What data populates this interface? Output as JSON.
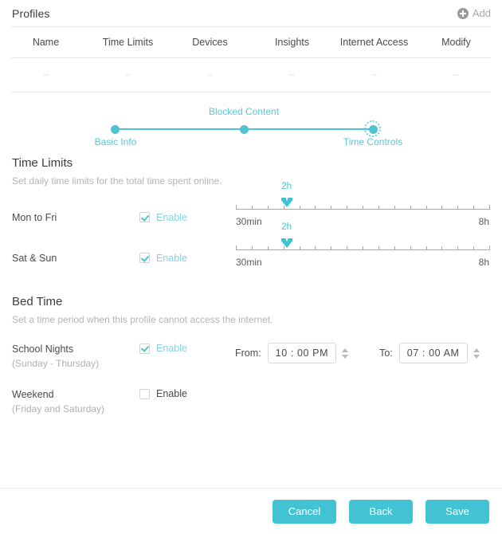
{
  "header": {
    "title": "Profiles",
    "add_label": "Add",
    "add_icon": "plus-circle-icon"
  },
  "table": {
    "columns": [
      "Name",
      "Time Limits",
      "Devices",
      "Insights",
      "Internet Access",
      "Modify"
    ],
    "rows": [
      [
        "--",
        "--",
        "--",
        "--",
        "--",
        "--"
      ]
    ]
  },
  "stepper": {
    "steps": [
      {
        "label": "Basic Info",
        "state": "done"
      },
      {
        "label": "Blocked Content",
        "state": "done"
      },
      {
        "label": "Time Controls",
        "state": "active"
      }
    ]
  },
  "time_limits": {
    "title": "Time Limits",
    "description": "Set daily time limits for the total time spent online.",
    "rows": [
      {
        "label": "Mon to Fri",
        "enable_label": "Enable",
        "enabled": true,
        "slider": {
          "value_label": "2h",
          "min_label": "30min",
          "max_label": "8h",
          "value_percent": 20,
          "ticks": 16
        }
      },
      {
        "label": "Sat & Sun",
        "enable_label": "Enable",
        "enabled": true,
        "slider": {
          "value_label": "2h",
          "min_label": "30min",
          "max_label": "8h",
          "value_percent": 20,
          "ticks": 16
        }
      }
    ]
  },
  "bed_time": {
    "title": "Bed Time",
    "description": "Set a time period when this profile cannot access the internet.",
    "rows": [
      {
        "label": "School Nights",
        "sub_label": "(Sunday - Thursday)",
        "enable_label": "Enable",
        "enabled": true,
        "from_label": "From:",
        "from_value": "10 : 00  PM",
        "to_label": "To:",
        "to_value": "07 : 00  AM"
      },
      {
        "label": "Weekend",
        "sub_label": "(Friday and Saturday)",
        "enable_label": "Enable",
        "enabled": false
      }
    ]
  },
  "footer": {
    "cancel_label": "Cancel",
    "back_label": "Back",
    "save_label": "Save"
  },
  "colors": {
    "accent": "#41c3d3",
    "accent_light": "#7fd4e0",
    "text_dark": "#3c3c3c",
    "text_muted": "#b4b4b4"
  }
}
